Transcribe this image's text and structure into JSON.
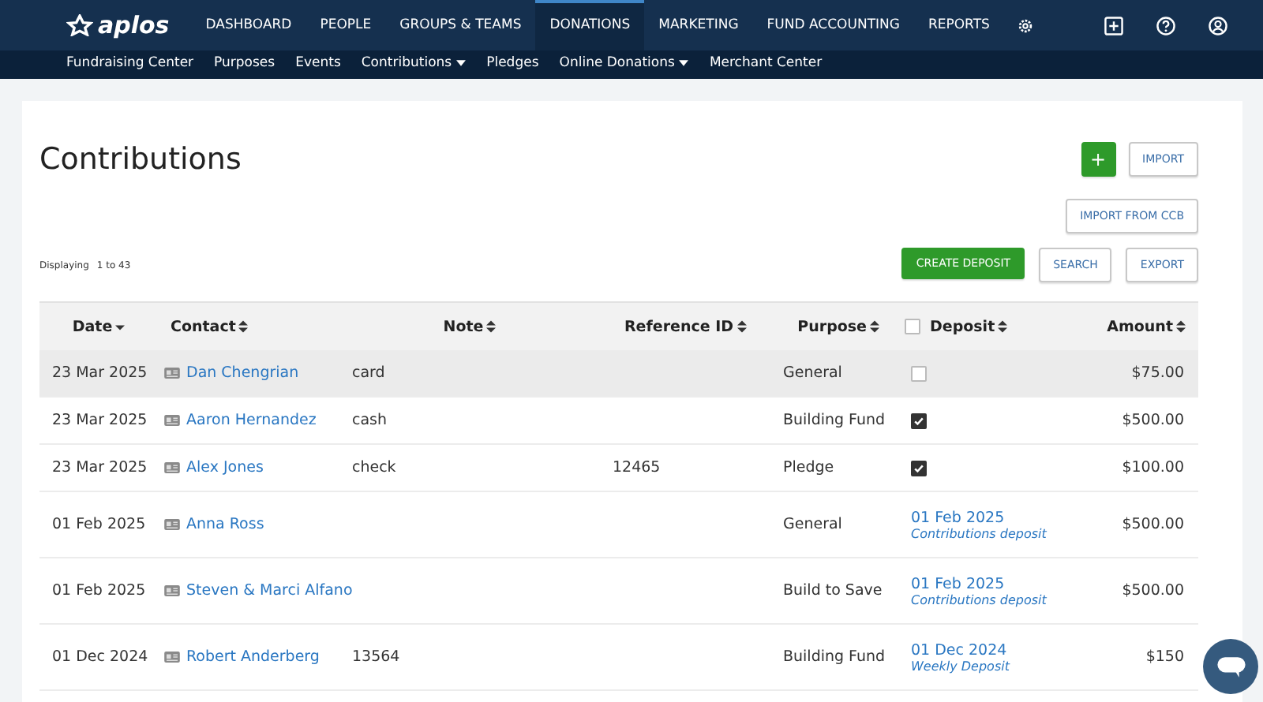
{
  "nav": {
    "logo": "aplos",
    "items": [
      {
        "label": "DASHBOARD",
        "selected": false
      },
      {
        "label": "PEOPLE",
        "selected": false
      },
      {
        "label": "GROUPS & TEAMS",
        "selected": false
      },
      {
        "label": "DONATIONS",
        "selected": true
      },
      {
        "label": "MARKETING",
        "selected": false
      },
      {
        "label": "FUND ACCOUNTING",
        "selected": false
      },
      {
        "label": "REPORTS",
        "selected": false
      }
    ]
  },
  "subnav": [
    {
      "label": "Fundraising Center",
      "dropdown": false
    },
    {
      "label": "Purposes",
      "dropdown": false
    },
    {
      "label": "Events",
      "dropdown": false
    },
    {
      "label": "Contributions",
      "dropdown": true
    },
    {
      "label": "Pledges",
      "dropdown": false
    },
    {
      "label": "Online Donations",
      "dropdown": true
    },
    {
      "label": "Merchant Center",
      "dropdown": false
    }
  ],
  "page": {
    "title": "Contributions",
    "add_button": "+",
    "import_button": "IMPORT",
    "import_ccb_button": "IMPORT FROM CCB",
    "displaying_label": "Displaying",
    "displaying_range": "1 to 43",
    "actions": [
      {
        "label": "CREATE DEPOSIT",
        "primary": true
      },
      {
        "label": "SEARCH",
        "primary": false
      },
      {
        "label": "EXPORT",
        "primary": false
      }
    ]
  },
  "table": {
    "columns": [
      {
        "label": "Date",
        "sorted": true
      },
      {
        "label": "Contact",
        "sorted": false
      },
      {
        "label": "Note",
        "sorted": false
      },
      {
        "label": "Reference ID",
        "sorted": false
      },
      {
        "label": "Purpose",
        "sorted": false
      },
      {
        "label": "Deposit",
        "sorted": false,
        "checked": false
      },
      {
        "label": "Amount",
        "sorted": false
      }
    ],
    "rows": [
      {
        "selected": true,
        "date": "23 Mar 2025",
        "contact": "Dan Chengrian",
        "note": "card",
        "reference": "",
        "purpose": "General",
        "deposit": {
          "kind": "checkbox",
          "checked": false
        },
        "amount": "$75.00"
      },
      {
        "selected": false,
        "date": "23 Mar 2025",
        "contact": "Aaron Hernandez",
        "note": "cash",
        "reference": "",
        "purpose": "Building Fund",
        "deposit": {
          "kind": "checkbox",
          "checked": true
        },
        "amount": "$500.00"
      },
      {
        "selected": false,
        "date": "23 Mar 2025",
        "contact": "Alex Jones",
        "note": "check",
        "reference": "12465",
        "purpose": "Pledge",
        "deposit": {
          "kind": "checkbox",
          "checked": true
        },
        "amount": "$100.00"
      },
      {
        "selected": false,
        "date": "01 Feb 2025",
        "contact": "Anna Ross",
        "note": "",
        "reference": "",
        "purpose": "General",
        "deposit": {
          "kind": "link",
          "date": "01 Feb 2025",
          "name": "Contributions deposit"
        },
        "amount": "$500.00"
      },
      {
        "selected": false,
        "date": "01 Feb 2025",
        "contact": "Steven & Marci Alfano",
        "note": "",
        "reference": "",
        "purpose": "Build to Save",
        "deposit": {
          "kind": "link",
          "date": "01 Feb 2025",
          "name": "Contributions deposit"
        },
        "amount": "$500.00"
      },
      {
        "selected": false,
        "date": "01 Dec 2024",
        "contact": "Robert Anderberg",
        "note": "13564",
        "reference": "",
        "purpose": "Building Fund",
        "deposit": {
          "kind": "link",
          "date": "01 Dec 2024",
          "name": "Weekly Deposit"
        },
        "amount": "$150"
      }
    ]
  }
}
